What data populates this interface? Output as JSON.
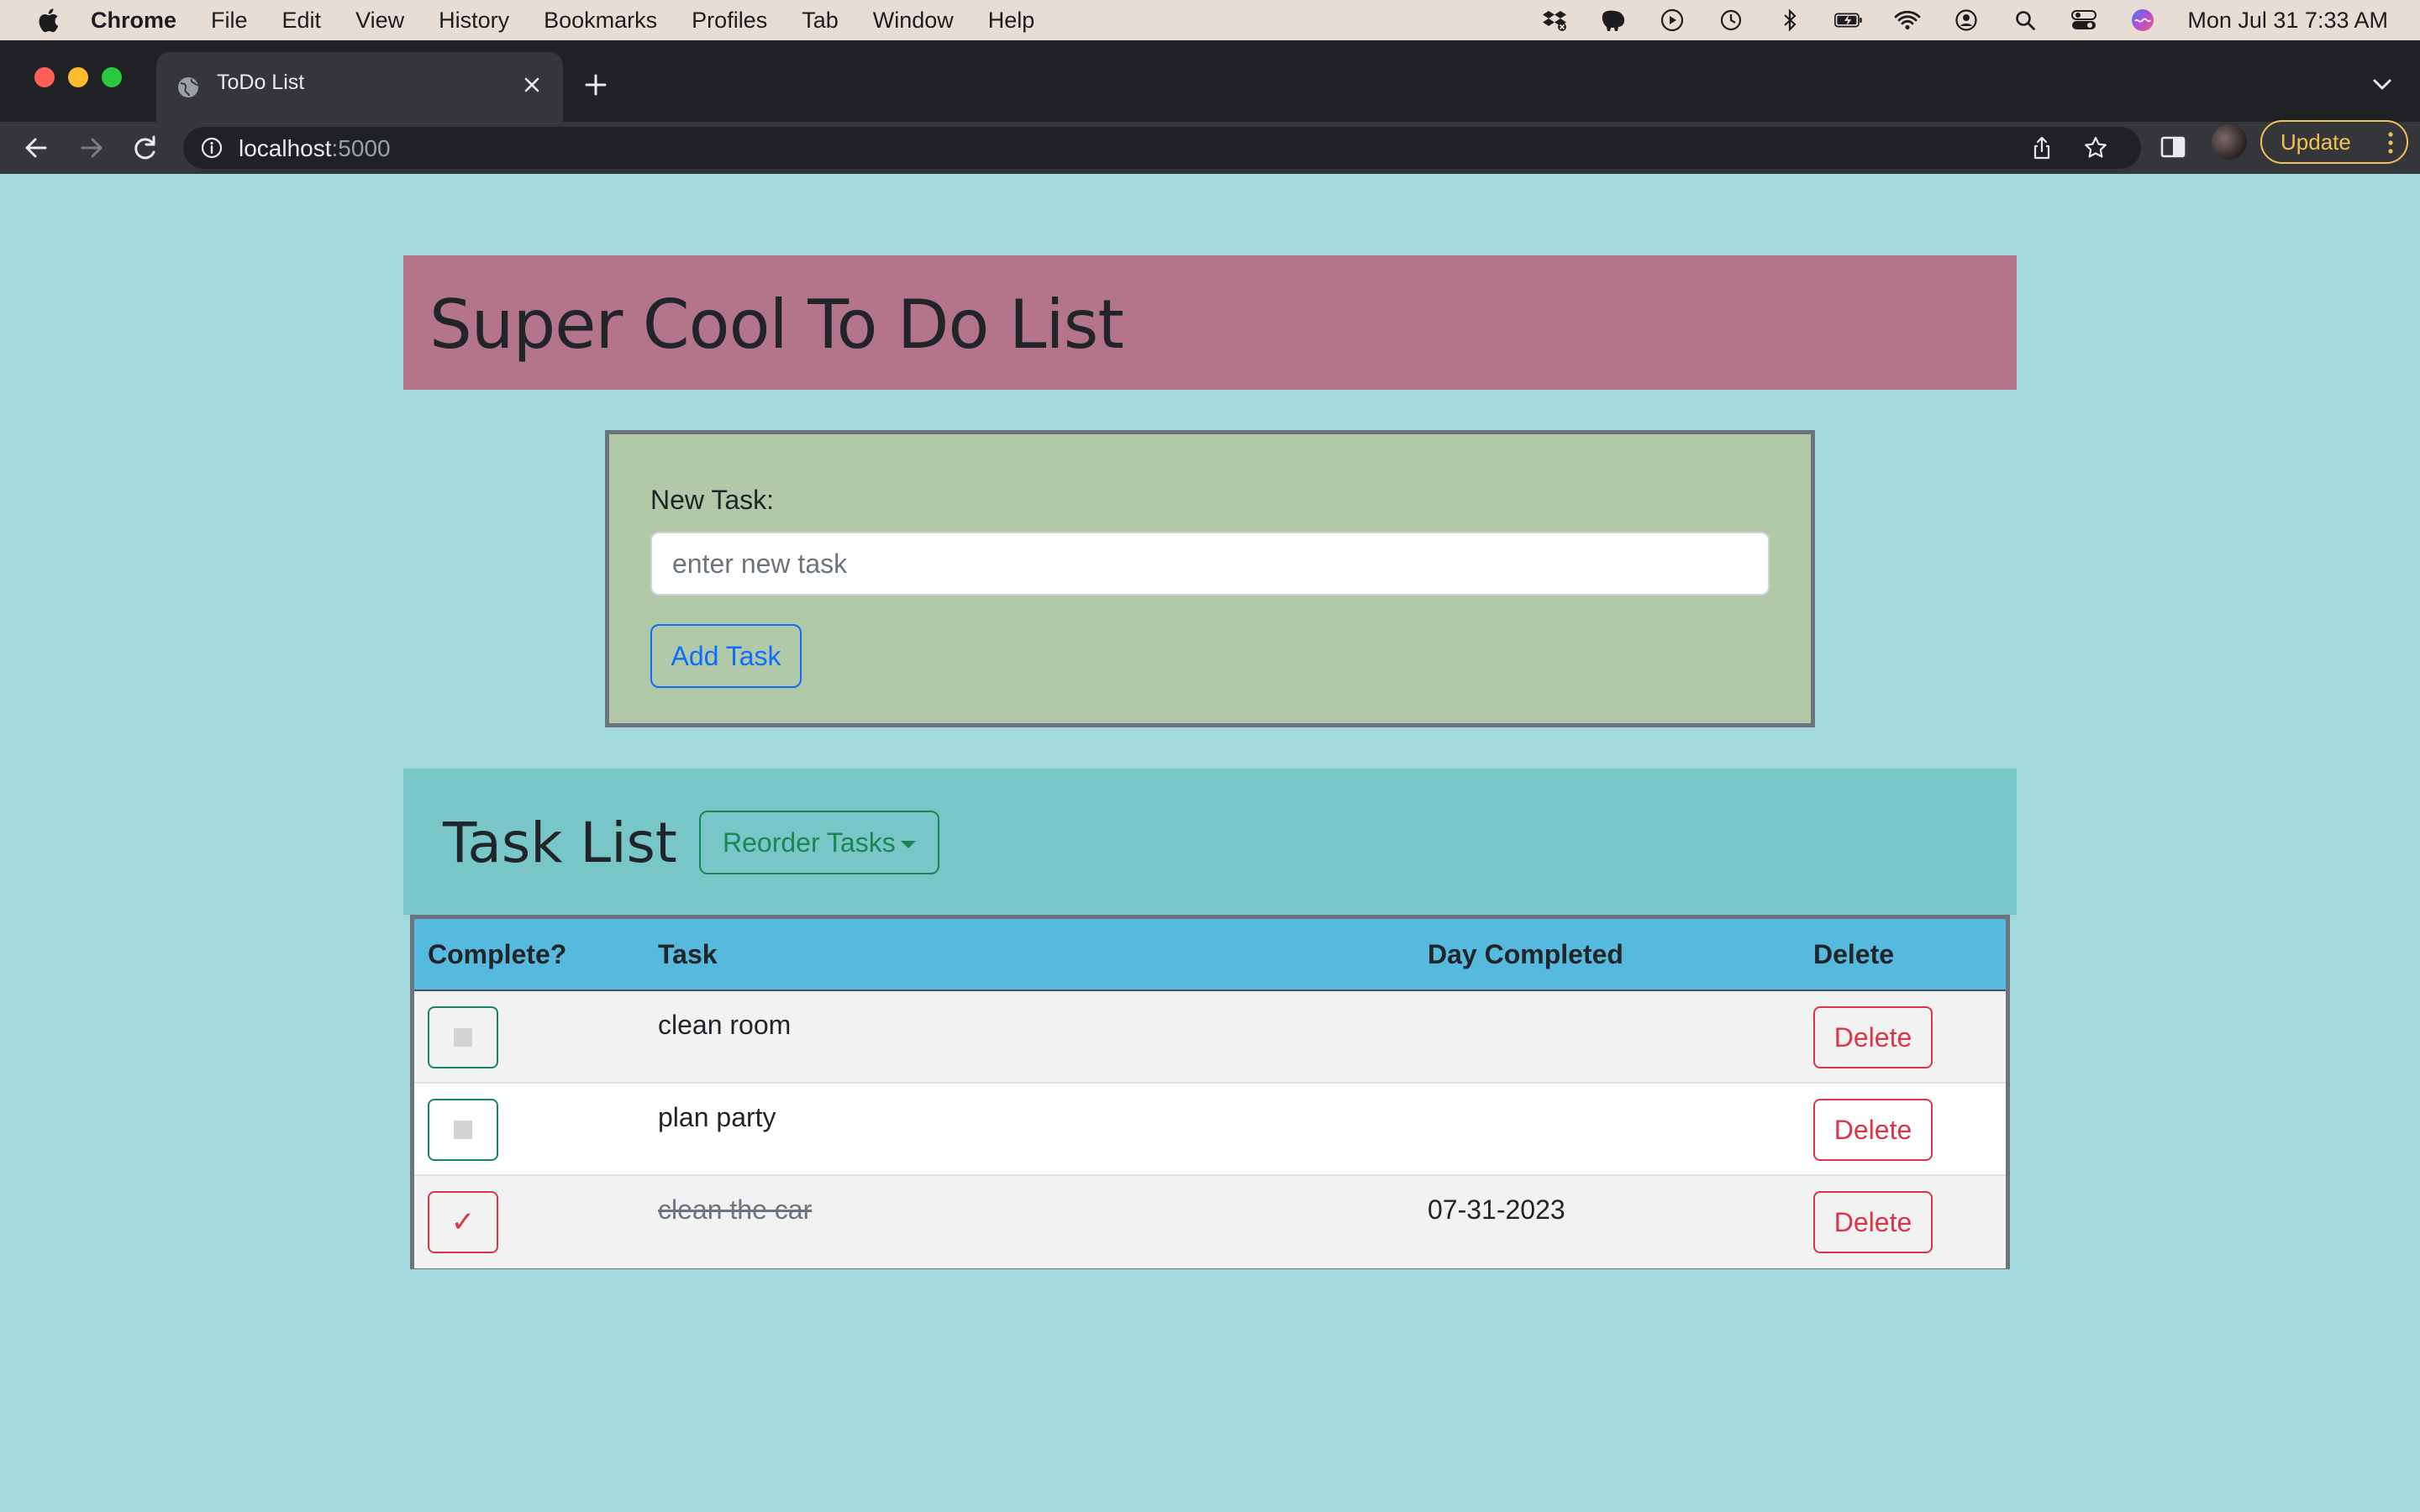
{
  "menubar": {
    "app_name": "Chrome",
    "items": [
      "File",
      "Edit",
      "View",
      "History",
      "Bookmarks",
      "Profiles",
      "Tab",
      "Window",
      "Help"
    ],
    "clock": "Mon Jul 31  7:33 AM",
    "status_icons": [
      "dropbox-icon",
      "evernote-icon",
      "play-icon",
      "time-machine-icon",
      "bluetooth-icon",
      "battery-icon",
      "wifi-icon",
      "user-icon",
      "spotlight-icon",
      "control-center-icon",
      "siri-icon"
    ]
  },
  "browser": {
    "tab_title": "ToDo List",
    "url_host": "localhost",
    "url_port": ":5000",
    "update_label": "Update"
  },
  "page": {
    "title": "Super Cool To Do List",
    "form": {
      "label": "New Task:",
      "placeholder": "enter new task",
      "value": "",
      "add_label": "Add Task"
    },
    "task_list": {
      "heading": "Task List",
      "reorder_label": "Reorder Tasks",
      "columns": {
        "complete": "Complete?",
        "task": "Task",
        "day": "Day Completed",
        "delete": "Delete"
      },
      "rows": [
        {
          "task": "clean room",
          "completed": false,
          "day": "",
          "delete_label": "Delete"
        },
        {
          "task": "plan party",
          "completed": false,
          "day": "",
          "delete_label": "Delete"
        },
        {
          "task": "clean the car",
          "completed": true,
          "day": "07-31-2023",
          "delete_label": "Delete"
        }
      ]
    }
  },
  "colors": {
    "page_bg": "#a2d9dc",
    "header_bg": "#b4758a",
    "form_bg": "#b1c8a9",
    "tasklist_header_bg": "#79c6c9",
    "table_header_bg": "#56b9de",
    "primary": "#0d6efd",
    "success": "#198754",
    "danger": "#dc3545"
  }
}
